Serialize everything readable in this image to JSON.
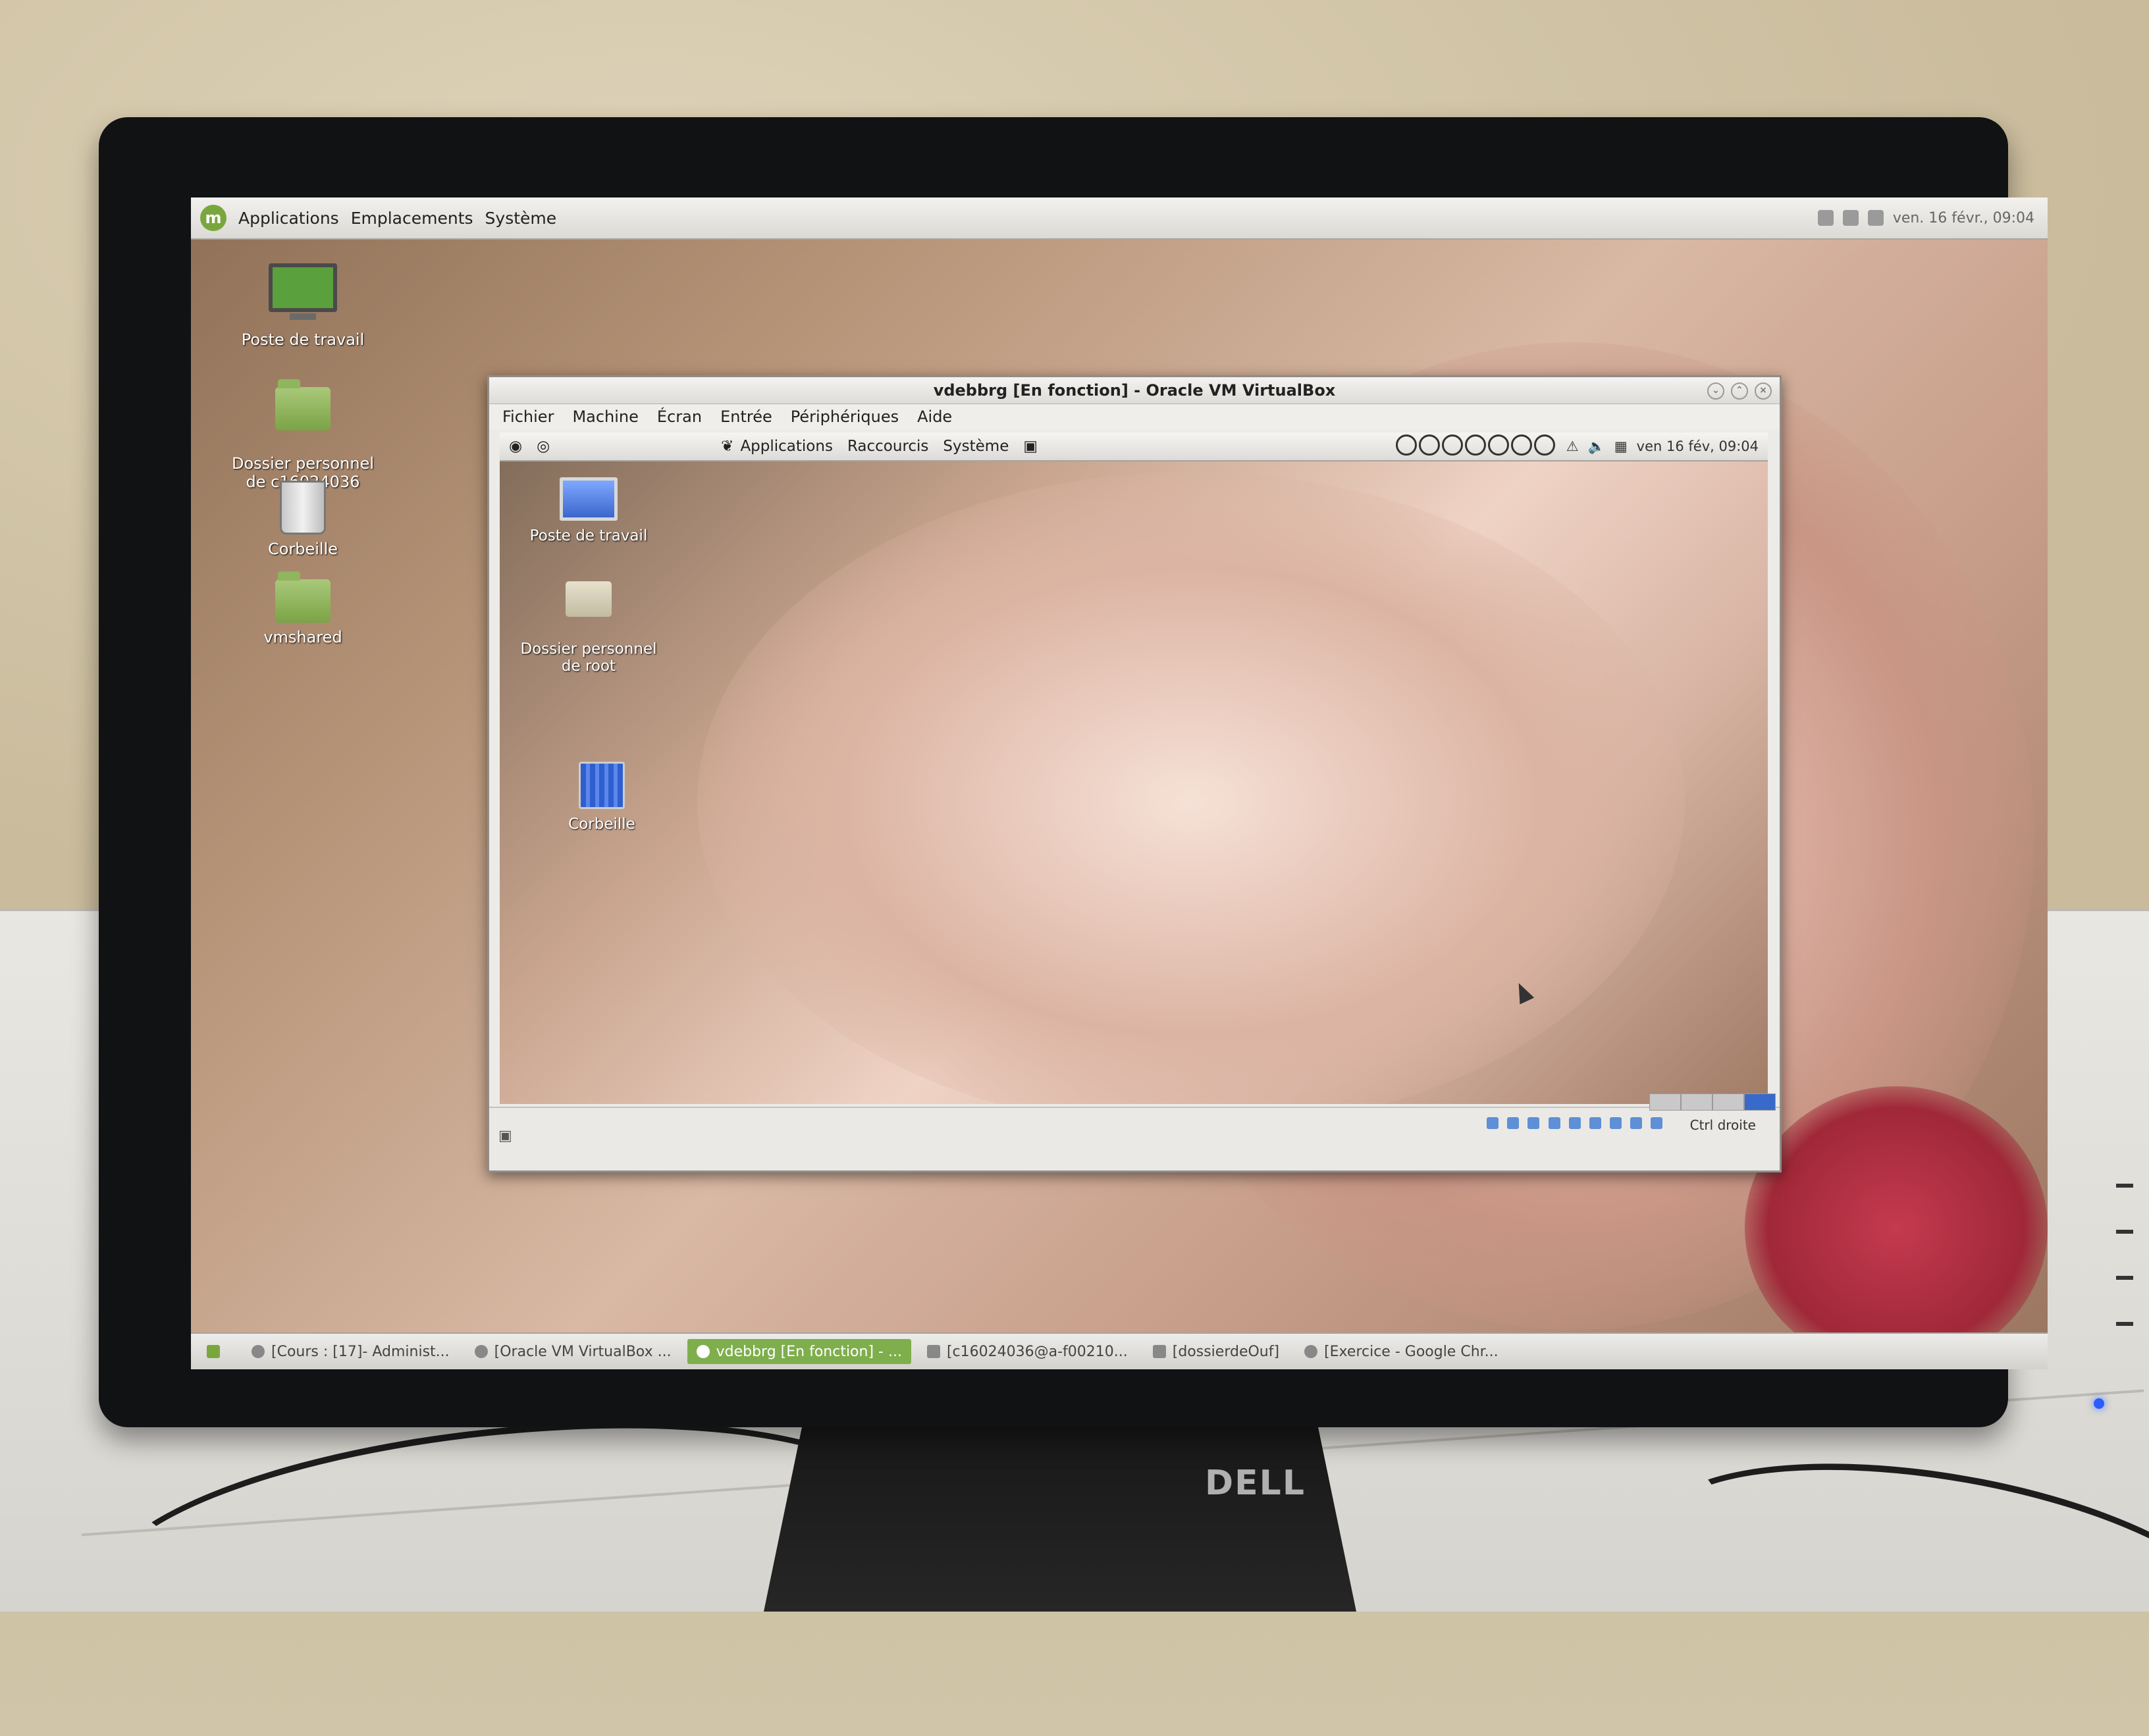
{
  "host": {
    "menu": [
      "Applications",
      "Emplacements",
      "Système"
    ],
    "clock": "ven. 16 févr., 09:04",
    "desktop_icons": [
      {
        "label": "Poste de travail",
        "icon": "computer-icon"
      },
      {
        "label": "Dossier personnel\nde c16024036",
        "icon": "home-folder-icon"
      },
      {
        "label": "Corbeille",
        "icon": "trash-icon"
      },
      {
        "label": "vmshared",
        "icon": "folder-icon"
      }
    ],
    "taskbar": [
      {
        "label": "[Cours : [17]- Administ..."
      },
      {
        "label": "[Oracle VM VirtualBox ..."
      },
      {
        "label": "vdebbrg [En fonction] - ...",
        "active": true
      },
      {
        "label": "[c16024036@a-f00210..."
      },
      {
        "label": "[dossierdeOuf]"
      },
      {
        "label": "[Exercice - Google Chr..."
      }
    ]
  },
  "vbox": {
    "title": "vdebbrg [En fonction] - Oracle VM VirtualBox",
    "menu": [
      "Fichier",
      "Machine",
      "Écran",
      "Entrée",
      "Périphériques",
      "Aide"
    ],
    "status_label": "Ctrl droite"
  },
  "guest": {
    "menu": [
      "Applications",
      "Raccourcis",
      "Système"
    ],
    "clock": "ven 16 fév, 09:04",
    "desktop_icons": [
      {
        "label": "Poste de travail",
        "icon": "computer-icon"
      },
      {
        "label": "Dossier personnel\nde root",
        "icon": "home-folder-icon"
      },
      {
        "label": "Corbeille",
        "icon": "trash-icon"
      }
    ]
  },
  "brand": "DELL",
  "colors": {
    "accent": "#7aa73d",
    "vbox_active": "#3a6ac9"
  }
}
